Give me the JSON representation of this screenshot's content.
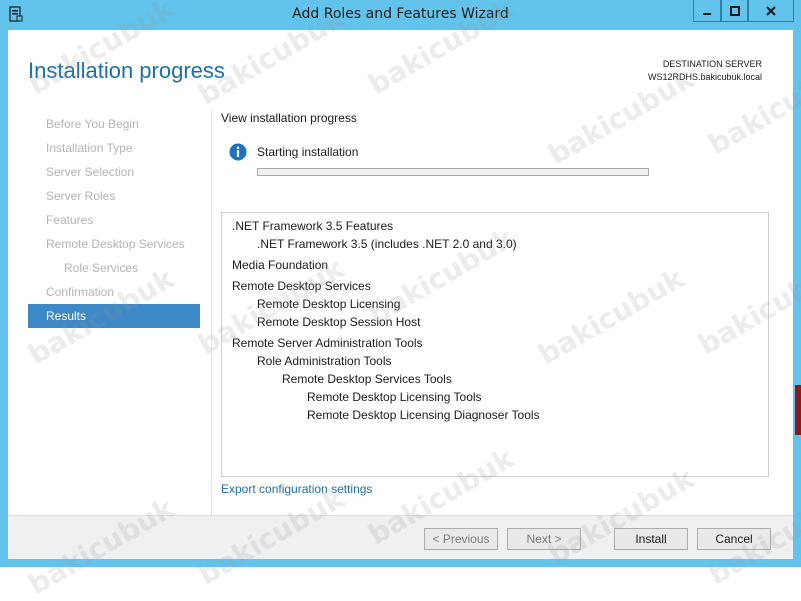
{
  "window": {
    "title": "Add Roles and Features Wizard"
  },
  "header": {
    "page_title": "Installation progress",
    "destination_label": "DESTINATION SERVER",
    "destination_server": "WS12RDHS.bakicubuk.local"
  },
  "nav": {
    "items": [
      {
        "label": "Before You Begin",
        "level": 0,
        "active": false
      },
      {
        "label": "Installation Type",
        "level": 0,
        "active": false
      },
      {
        "label": "Server Selection",
        "level": 0,
        "active": false
      },
      {
        "label": "Server Roles",
        "level": 0,
        "active": false
      },
      {
        "label": "Features",
        "level": 0,
        "active": false
      },
      {
        "label": "Remote Desktop Services",
        "level": 0,
        "active": false
      },
      {
        "label": "Role Services",
        "level": 1,
        "active": false
      },
      {
        "label": "Confirmation",
        "level": 0,
        "active": false
      },
      {
        "label": "Results",
        "level": 0,
        "active": true
      }
    ]
  },
  "main": {
    "view_label": "View installation progress",
    "status_text": "Starting installation",
    "progress_fraction": 0,
    "features": [
      {
        "label": ".NET Framework 3.5 Features",
        "level": 0
      },
      {
        "label": ".NET Framework 3.5 (includes .NET 2.0 and 3.0)",
        "level": 1
      },
      {
        "label": "Media Foundation",
        "level": 0
      },
      {
        "label": "Remote Desktop Services",
        "level": 0
      },
      {
        "label": "Remote Desktop Licensing",
        "level": 1
      },
      {
        "label": "Remote Desktop Session Host",
        "level": 1
      },
      {
        "label": "Remote Server Administration Tools",
        "level": 0
      },
      {
        "label": "Role Administration Tools",
        "level": 1
      },
      {
        "label": "Remote Desktop Services Tools",
        "level": 2
      },
      {
        "label": "Remote Desktop Licensing Tools",
        "level": 3
      },
      {
        "label": "Remote Desktop Licensing Diagnoser Tools",
        "level": 3
      }
    ],
    "export_link": "Export configuration settings"
  },
  "footer": {
    "previous": "< Previous",
    "next": "Next >",
    "install": "Install",
    "cancel": "Cancel"
  },
  "watermark": "bakicubuk",
  "colors": {
    "titlebar": "#62c4ec",
    "accent": "#1e6fa9",
    "nav_active": "#3c89c6"
  }
}
